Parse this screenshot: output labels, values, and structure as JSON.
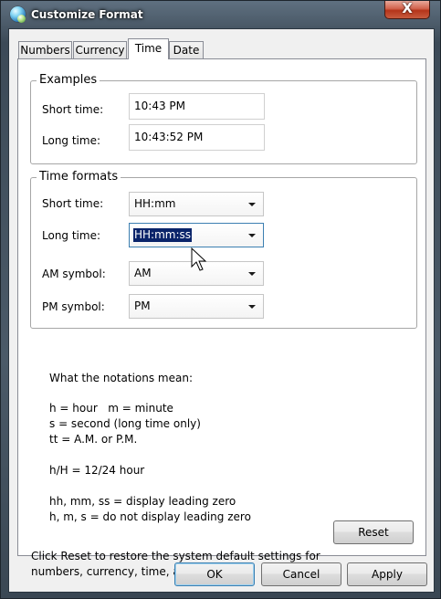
{
  "window": {
    "title": "Customize Format",
    "close_glyph": "X"
  },
  "tabs": [
    {
      "label": "Numbers",
      "active": false
    },
    {
      "label": "Currency",
      "active": false
    },
    {
      "label": "Time",
      "active": true
    },
    {
      "label": "Date",
      "active": false
    }
  ],
  "examples": {
    "title": "Examples",
    "short_label": "Short time:",
    "short_value": "10:43 PM",
    "long_label": "Long time:",
    "long_value": "10:43:52 PM"
  },
  "formats": {
    "title": "Time formats",
    "short_label": "Short time:",
    "short_value": "HH:mm",
    "long_label": "Long time:",
    "long_value": "HH:mm:ss",
    "am_label": "AM symbol:",
    "am_value": "AM",
    "pm_label": "PM symbol:",
    "pm_value": "PM"
  },
  "notes": {
    "heading": "What the notations mean:",
    "line1": "h = hour   m = minute",
    "line2": "s = second (long time only)",
    "line3": "tt = A.M. or P.M.",
    "line4": "h/H = 12/24 hour",
    "line5": "hh, mm, ss = display leading zero",
    "line6": "h, m, s = do not display leading zero"
  },
  "reset": {
    "text_line1": "Click Reset to restore the system default settings for",
    "text_line2": "numbers, currency, time, and date.",
    "button": "Reset"
  },
  "footer": {
    "ok": "OK",
    "cancel": "Cancel",
    "apply": "Apply"
  },
  "icons": {
    "app": "globe-icon",
    "cursor": "mouse-pointer-icon",
    "dropdown": "chevron-down-icon"
  }
}
